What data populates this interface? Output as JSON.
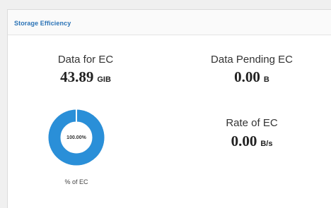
{
  "panel": {
    "title": "Storage Efficiency"
  },
  "metrics": {
    "data_for_ec": {
      "label": "Data for EC",
      "value": "43.89",
      "unit": "GIB"
    },
    "data_pending_ec": {
      "label": "Data Pending EC",
      "value": "0.00",
      "unit": "B"
    },
    "rate_of_ec": {
      "label": "Rate of EC",
      "value": "0.00",
      "unit": "B/s"
    }
  },
  "donut": {
    "center_text": "100.00%",
    "caption": "% of EC",
    "fraction": 1.0,
    "color": "#2a8fd8",
    "track_color": "#e6e6e6"
  }
}
